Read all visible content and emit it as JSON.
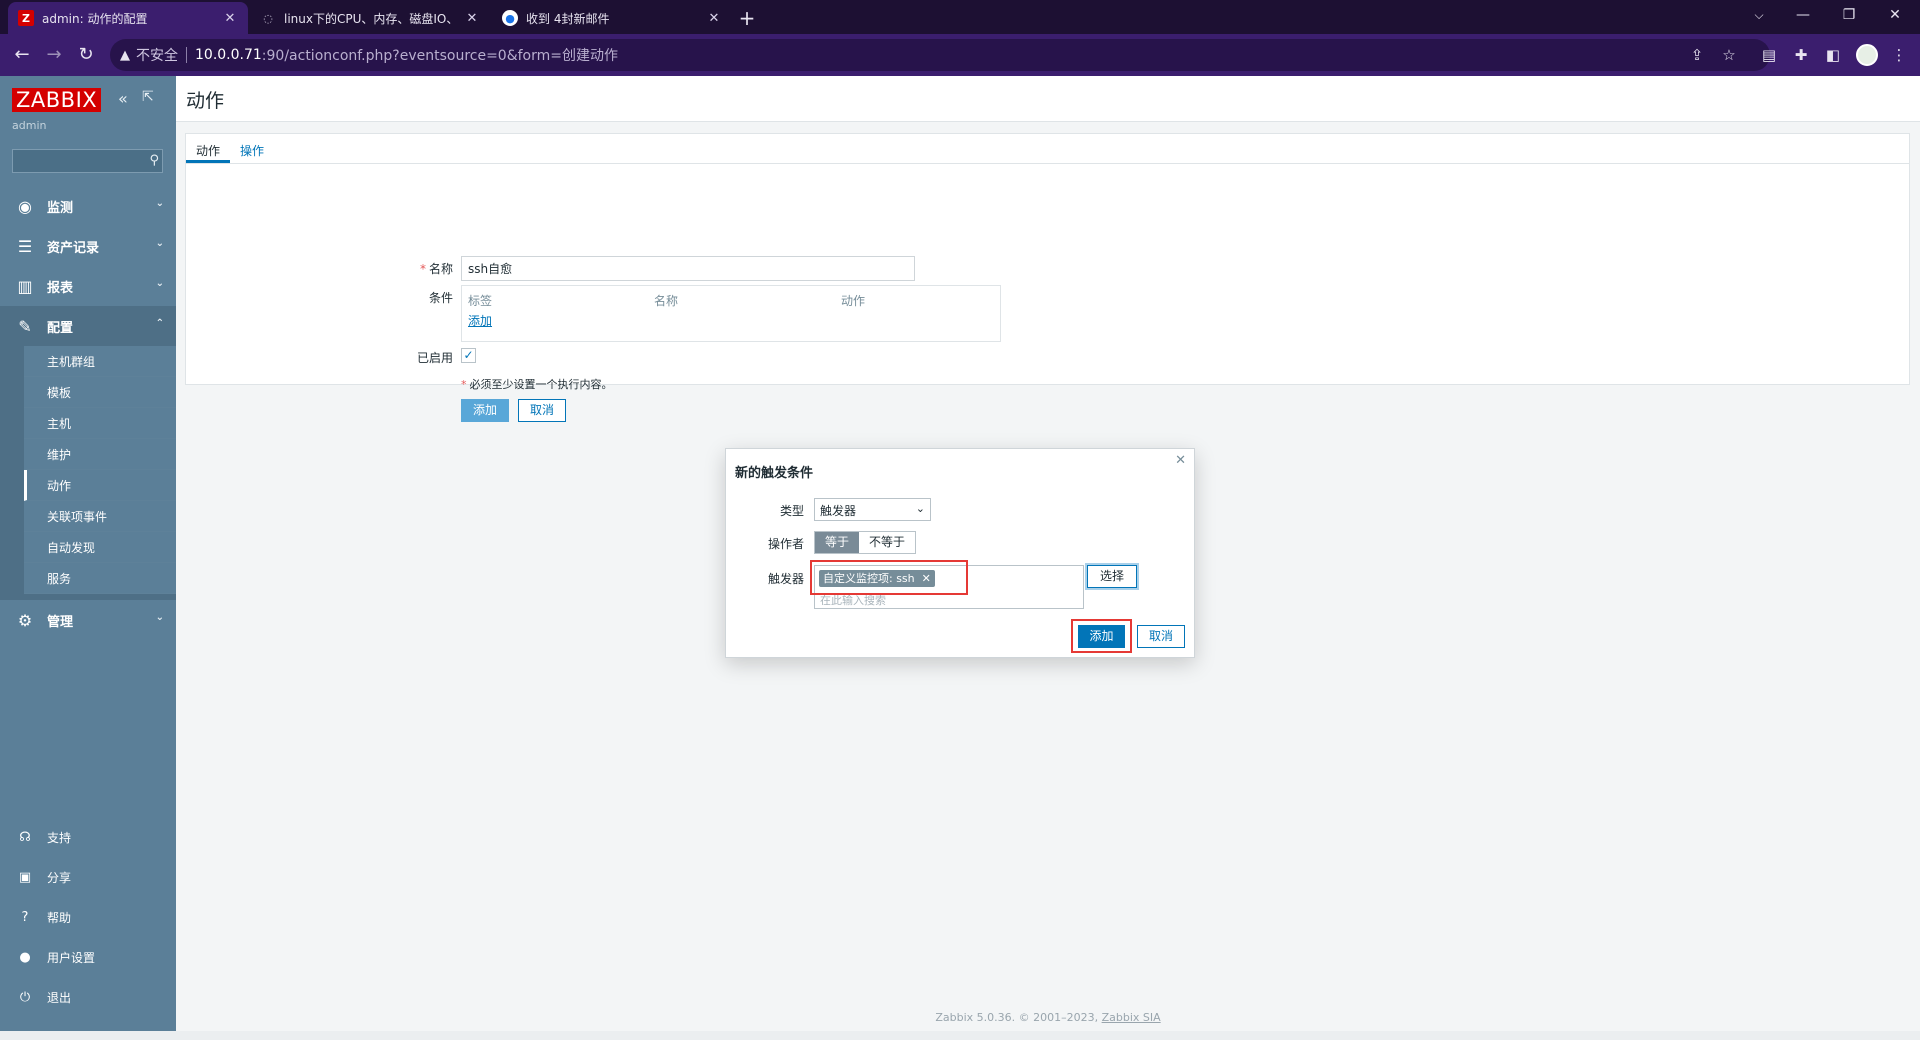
{
  "browser": {
    "tabs": [
      {
        "title": "admin: 动作的配置",
        "favicon": "Z",
        "favicon_color": "#d40000",
        "active": true
      },
      {
        "title": "linux下的CPU、内存、磁盘IO、",
        "favicon": "",
        "favicon_color": "#1d1033",
        "active": false
      },
      {
        "title": "收到 4封新邮件",
        "favicon": "",
        "favicon_color": "#ffffff",
        "active": false
      }
    ],
    "insecure_label": "不安全",
    "url_host": "10.0.0.71",
    "url_rest": ":90/actionconf.php?eventsource=0&form=创建动作"
  },
  "sidebar": {
    "logo": "ZABBIX",
    "user": "admin",
    "menu": [
      {
        "label": "监测",
        "icon": "eye-icon"
      },
      {
        "label": "资产记录",
        "icon": "list-icon"
      },
      {
        "label": "报表",
        "icon": "bar-chart-icon"
      },
      {
        "label": "配置",
        "icon": "wrench-icon"
      },
      {
        "label": "管理",
        "icon": "gear-icon"
      }
    ],
    "config_submenu": [
      "主机群组",
      "模板",
      "主机",
      "维护",
      "动作",
      "关联项事件",
      "自动发现",
      "服务"
    ],
    "bottom": [
      {
        "label": "支持",
        "icon": "headset-icon"
      },
      {
        "label": "分享",
        "icon": "share-icon"
      },
      {
        "label": "帮助",
        "icon": "help-icon"
      },
      {
        "label": "用户设置",
        "icon": "user-icon"
      },
      {
        "label": "退出",
        "icon": "power-icon"
      }
    ]
  },
  "page": {
    "title": "动作",
    "tabs": [
      "动作",
      "操作"
    ],
    "form": {
      "name_label": "名称",
      "name_value": "ssh自愈",
      "conditions_label": "条件",
      "cond_headers": [
        "标签",
        "名称",
        "动作"
      ],
      "cond_add": "添加",
      "enabled_label": "已启用",
      "warning": "必须至少设置一个执行内容。",
      "add_button": "添加",
      "cancel_button": "取消"
    },
    "footer_version": "Zabbix 5.0.36. © 2001–2023, ",
    "footer_link": "Zabbix SIA"
  },
  "modal": {
    "title": "新的触发条件",
    "type_label": "类型",
    "type_value": "触发器",
    "operator_label": "操作者",
    "operator_options": [
      "等于",
      "不等于"
    ],
    "trigger_label": "触发器",
    "trigger_chip": "自定义监控项: ssh",
    "trigger_placeholder": "在此输入搜索",
    "select_button": "选择",
    "add_button": "添加",
    "cancel_button": "取消"
  },
  "colors": {
    "highlight": "#e53935",
    "zabbix_blue": "#0275b8"
  }
}
